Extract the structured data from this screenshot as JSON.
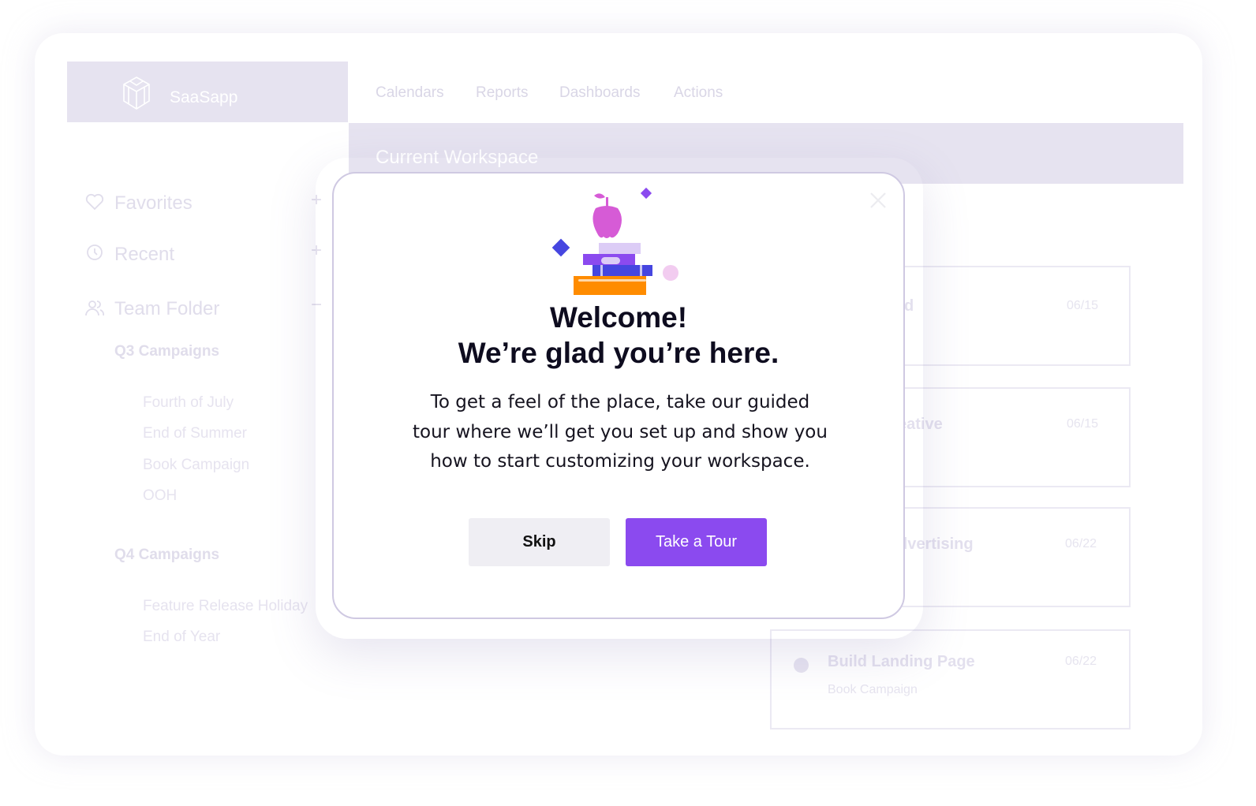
{
  "app": {
    "name": "SaaSapp",
    "logo_icon": "cube-icon"
  },
  "nav": [
    "Calendars",
    "Reports",
    "Dashboards",
    "Actions"
  ],
  "workspace": {
    "title": "Current Workspace"
  },
  "sidebar": {
    "items": [
      {
        "label": "Favorites",
        "icon": "heart-icon",
        "action": "+"
      },
      {
        "label": "Recent",
        "icon": "clock-icon",
        "action": "+"
      },
      {
        "label": "Team Folder",
        "icon": "users-icon",
        "action": "−"
      }
    ],
    "groups": [
      {
        "label": "Q3 Campaigns",
        "items": [
          "Fourth of July",
          "End of Summer",
          "Book Campaign",
          "OOH"
        ]
      },
      {
        "label": "Q4 Campaigns",
        "items": [
          "Feature Release Holiday",
          "End of Year"
        ]
      }
    ]
  },
  "cards": [
    {
      "title_visible": "d",
      "date": "06/15"
    },
    {
      "title_visible": "eative",
      "date": "06/15"
    },
    {
      "title_visible": "dvertising",
      "date": "06/22"
    },
    {
      "title": "Build Landing Page",
      "subtitle": "Book Campaign",
      "date": "06/22"
    }
  ],
  "modal": {
    "title_line1": "Welcome!",
    "title_line2": "We’re glad you’re here.",
    "body_lines": [
      "To get a feel of the place, take our guided",
      "tour where we’ll get you set up and show you",
      "how to start customizing your workspace."
    ],
    "skip_label": "Skip",
    "tour_label": "Take a Tour",
    "colors": {
      "primary": "#8b4aef",
      "apple": "#d65bd6",
      "orange": "#ff8c00",
      "blue": "#4646e0"
    }
  }
}
